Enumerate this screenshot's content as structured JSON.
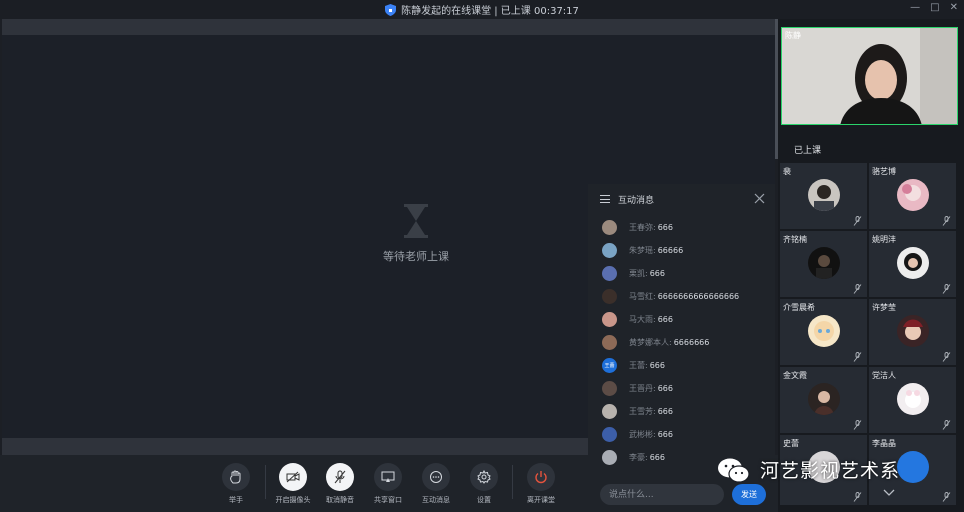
{
  "window": {
    "title": "陈静发起的在线课堂 | 已上课 00:37:17"
  },
  "stage": {
    "waiting_text": "等待老师上课"
  },
  "toolbar": {
    "buttons": [
      {
        "label": "举手",
        "icon": "hand-icon"
      },
      {
        "label": "开启摄像头",
        "icon": "camera-off-icon"
      },
      {
        "label": "取消静音",
        "icon": "mic-off-icon"
      },
      {
        "label": "共享窗口",
        "icon": "screen-share-icon"
      },
      {
        "label": "互动消息",
        "icon": "chat-bubble-icon"
      },
      {
        "label": "设置",
        "icon": "gear-icon"
      },
      {
        "label": "离开课堂",
        "icon": "power-icon"
      }
    ]
  },
  "chat": {
    "title": "互动消息",
    "messages": [
      {
        "name": "王春弥:",
        "text": "666"
      },
      {
        "name": "朱梦瑶:",
        "text": "66666"
      },
      {
        "name": "栗凯:",
        "text": "666"
      },
      {
        "name": "马雪红:",
        "text": "6666666666666666"
      },
      {
        "name": "马大雨:",
        "text": "666"
      },
      {
        "name": "黄梦娜本人:",
        "text": "6666666"
      },
      {
        "name": "王蕾:",
        "text": "666",
        "avatar_text": "王蕾"
      },
      {
        "name": "王晋丹:",
        "text": "666"
      },
      {
        "name": "王雪芳:",
        "text": "666"
      },
      {
        "name": "武彬彬:",
        "text": "666"
      },
      {
        "name": "李豪:",
        "text": "666"
      }
    ],
    "input_placeholder": "说点什么...",
    "send_label": "发送"
  },
  "teacher": {
    "name": "陈静"
  },
  "status_label": "已上课",
  "students": [
    {
      "name": "裴"
    },
    {
      "name": "骆艺博"
    },
    {
      "name": "齐铭楠"
    },
    {
      "name": "姚明沣"
    },
    {
      "name": "介雪晨希"
    },
    {
      "name": "许梦莹"
    },
    {
      "name": "金文霞"
    },
    {
      "name": "党洁人"
    },
    {
      "name": "史蕾"
    },
    {
      "name": "李晶晶"
    }
  ],
  "watermark": "河艺影视艺术系",
  "colors": {
    "accent": "#1e6fd9",
    "active_border": "#2bd46b",
    "leave": "#e5533d"
  }
}
